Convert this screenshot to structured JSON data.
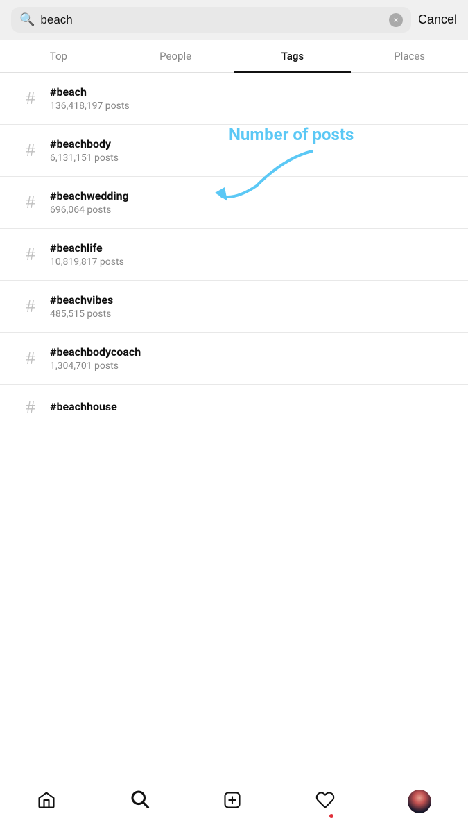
{
  "search": {
    "value": "beach",
    "placeholder": "Search",
    "clear_label": "×",
    "cancel_label": "Cancel"
  },
  "tabs": [
    {
      "id": "top",
      "label": "Top",
      "active": false
    },
    {
      "id": "people",
      "label": "People",
      "active": false
    },
    {
      "id": "tags",
      "label": "Tags",
      "active": true
    },
    {
      "id": "places",
      "label": "Places",
      "active": false
    }
  ],
  "annotation": {
    "text": "Number of posts",
    "color": "#5bc8f5"
  },
  "tags": [
    {
      "name": "#beach",
      "posts": "136,418,197 posts"
    },
    {
      "name": "#beachbody",
      "posts": "6,131,151 posts"
    },
    {
      "name": "#beachwedding",
      "posts": "696,064 posts"
    },
    {
      "name": "#beachlife",
      "posts": "10,819,817 posts"
    },
    {
      "name": "#beachvibes",
      "posts": "485,515 posts"
    },
    {
      "name": "#beachbodycoach",
      "posts": "1,304,701 posts"
    },
    {
      "name": "#beachhouse",
      "posts": ""
    }
  ],
  "bottom_nav": {
    "items": [
      {
        "id": "home",
        "label": "Home"
      },
      {
        "id": "search",
        "label": "Search"
      },
      {
        "id": "add",
        "label": "Add"
      },
      {
        "id": "heart",
        "label": "Activity"
      },
      {
        "id": "profile",
        "label": "Profile"
      }
    ]
  }
}
